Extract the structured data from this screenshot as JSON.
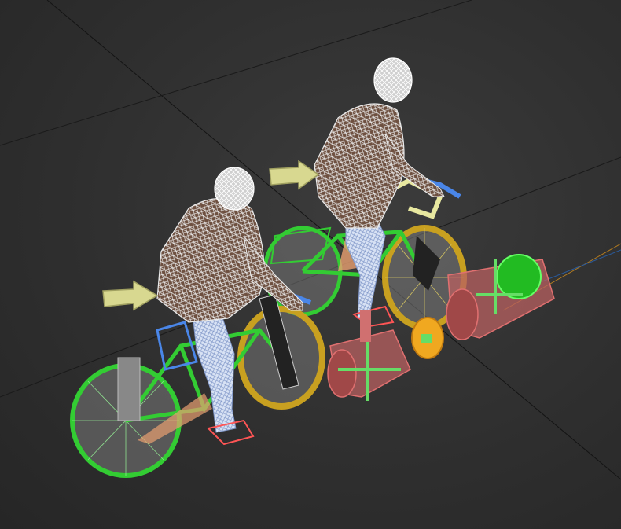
{
  "viewport": {
    "view_type": "perspective-3d-viewport",
    "background_color": "#2f2f2f",
    "grid_color": "#111111",
    "axis_color": "#d6a020"
  },
  "scene": {
    "riders": [
      {
        "name": "rider-front",
        "mesh_color": "#e8e8e8",
        "mesh_fill": "#7a5a4a",
        "jeans_color": "#c9d6ee"
      },
      {
        "name": "rider-rear",
        "mesh_color": "#e8e8e8",
        "mesh_fill": "#7a5a4a",
        "jeans_color": "#c9d6ee"
      }
    ],
    "bicycles": [
      {
        "name": "bicycle-front",
        "frame_color": "#33cc33",
        "tire_color": "#c8a020",
        "handle_color": "#4a86e8"
      },
      {
        "name": "bicycle-rear",
        "frame_color": "#33cc33",
        "tire_color": "#c8a020",
        "handle_color": "#4a86e8"
      }
    ],
    "rig_helpers": {
      "arrow_color": "#d8d890",
      "cylinder_color": "#e07070",
      "cylinder_fill": "#b86060",
      "gear_color": "#f0a820",
      "cross_color": "#66dd66",
      "pedal_color": "#ff5555"
    }
  }
}
